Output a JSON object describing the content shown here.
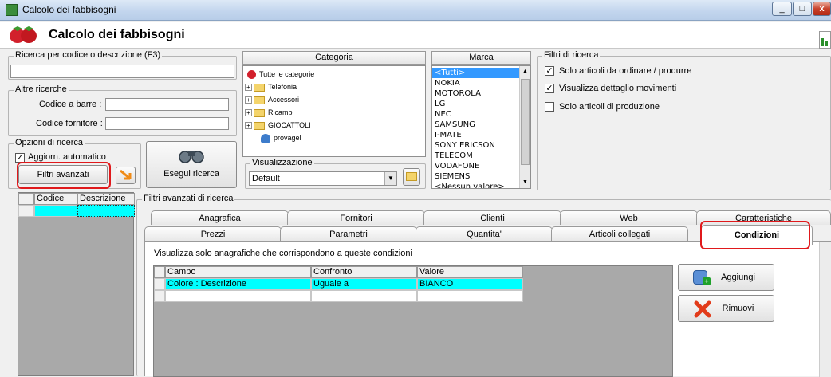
{
  "window": {
    "title": "Calcolo dei fabbisogni",
    "min": "_",
    "max": "□",
    "close": "x"
  },
  "header": {
    "title": "Calcolo dei fabbisogni"
  },
  "search": {
    "legend": "Ricerca per codice o descrizione (F3)",
    "value": ""
  },
  "other_search": {
    "legend": "Altre ricerche",
    "barcode_label": "Codice a barre :",
    "supplier_label": "Codice fornitore :"
  },
  "options": {
    "legend": "Opzioni di ricerca",
    "auto_update_label": "Aggiorn. automatico",
    "advanced_filters_button": "Filtri avanzati",
    "run_search_button": "Esegui ricerca"
  },
  "category": {
    "header": "Categoria",
    "items": [
      "Tutte le categorie",
      "Telefonia",
      "Accessori",
      "Ricambi",
      "GIOCATTOLI",
      "provagel"
    ]
  },
  "view": {
    "legend": "Visualizzazione",
    "selected": "Default"
  },
  "brand": {
    "header": "Marca",
    "items": [
      "<Tutti>",
      "NOKIA",
      "MOTOROLA",
      "LG",
      "NEC",
      "SAMSUNG",
      "I-MATE",
      "SONY ERICSON",
      "TELECOM",
      "VODAFONE",
      "SIEMENS",
      "<Nessun valore>"
    ]
  },
  "filters": {
    "legend": "Filtri di ricerca",
    "items": [
      {
        "label": "Solo articoli da ordinare / produrre",
        "checked": true
      },
      {
        "label": "Visualizza dettaglio movimenti",
        "checked": true
      },
      {
        "label": "Solo articoli di produzione",
        "checked": false
      }
    ]
  },
  "left_grid": {
    "col_code": "Codice",
    "col_desc": "Descrizione"
  },
  "advanced": {
    "legend": "Filtri avanzati di ricerca",
    "tabs_row1": [
      "Anagrafica",
      "Fornitori",
      "Clienti",
      "Web",
      "Caratteristiche"
    ],
    "tabs_row2": [
      "Prezzi",
      "Parametri",
      "Quantita'",
      "Articoli collegati",
      "Condizioni"
    ],
    "description": "Visualizza solo anagrafiche che corrispondono a queste condizioni",
    "columns": [
      "Campo",
      "Confronto",
      "Valore"
    ],
    "rows": [
      {
        "field": "Colore : Descrizione",
        "compare": "Uguale a",
        "value": "BIANCO"
      }
    ],
    "add_button": "Aggiungi",
    "remove_button": "Rimuovi"
  },
  "colors": {
    "selected_row": "#00ffff",
    "highlight": "#e0191c",
    "list_selection": "#3399ff"
  }
}
